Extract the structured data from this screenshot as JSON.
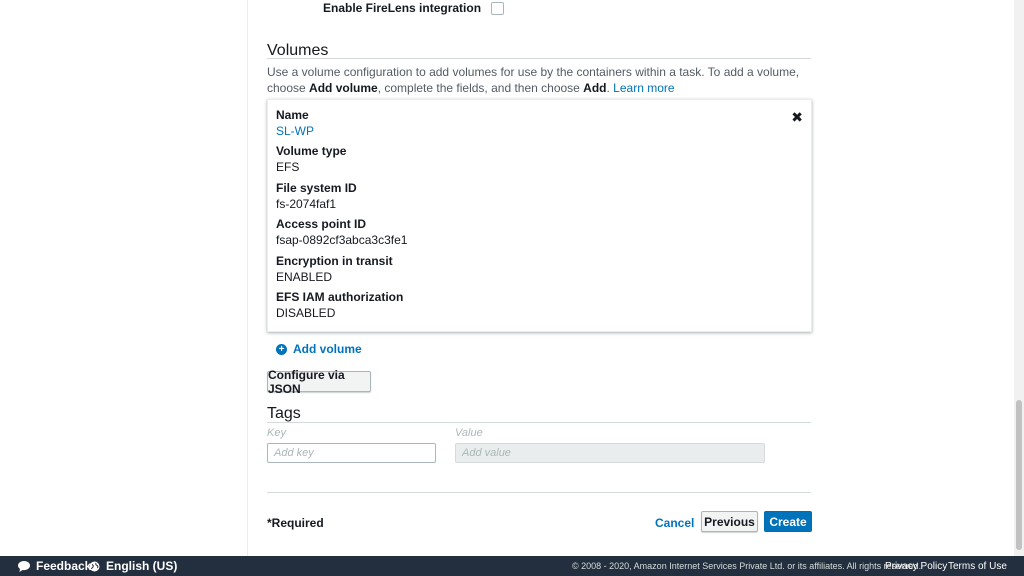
{
  "firelens": {
    "label": "Enable FireLens integration"
  },
  "volumes": {
    "title": "Volumes",
    "description_prefix": "Use a volume configuration to add volumes for use by the containers within a task. To add a volume, choose ",
    "description_bold1": "Add volume",
    "description_mid": ", complete the fields, and then choose ",
    "description_bold2": "Add",
    "description_end": ". ",
    "learn_more": "Learn more",
    "card": {
      "name_label": "Name",
      "name_value": "SL-WP",
      "type_label": "Volume type",
      "type_value": "EFS",
      "fs_label": "File system ID",
      "fs_value": "fs-2074faf1",
      "ap_label": "Access point ID",
      "ap_value": "fsap-0892cf3abca3c3fe1",
      "enc_label": "Encryption in transit",
      "enc_value": "ENABLED",
      "iam_label": "EFS IAM authorization",
      "iam_value": "DISABLED",
      "close": "✖"
    },
    "add_volume": "Add volume",
    "configure_json": "Configure via JSON"
  },
  "tags": {
    "title": "Tags",
    "key_header": "Key",
    "value_header": "Value",
    "key_placeholder": "Add key",
    "value_placeholder": "Add value"
  },
  "actions": {
    "required": "*Required",
    "cancel": "Cancel",
    "previous": "Previous",
    "create": "Create"
  },
  "footer": {
    "feedback": "Feedback",
    "language": "English (US)",
    "copyright": "© 2008 - 2020, Amazon Internet Services Private Ltd. or its affiliates. All rights reserved.",
    "privacy": "Privacy Policy",
    "terms": "Terms of Use"
  },
  "colors": {
    "primary": "#0073bb",
    "footer_bg": "#232f3e"
  }
}
